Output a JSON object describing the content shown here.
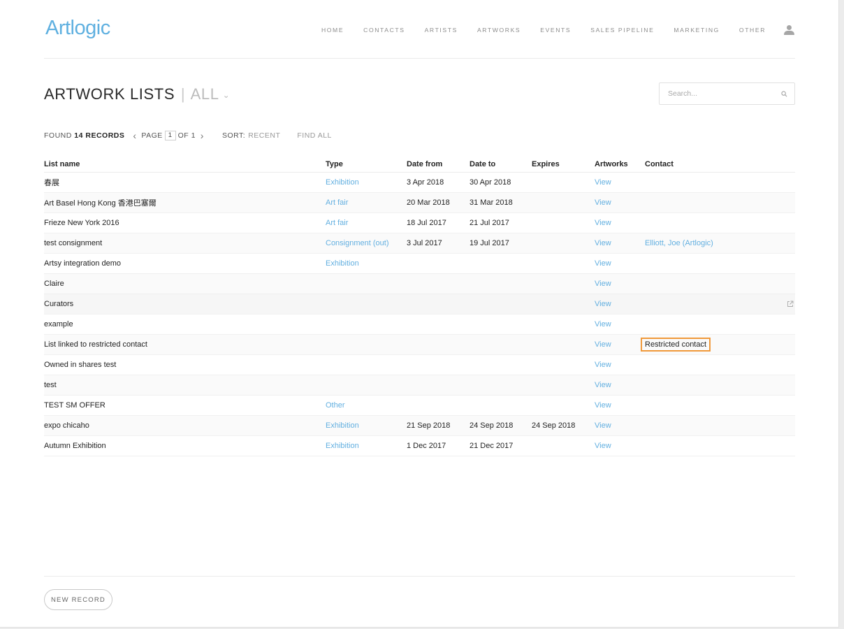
{
  "header": {
    "logo": "Artlogic",
    "nav": [
      "HOME",
      "CONTACTS",
      "ARTISTS",
      "ARTWORKS",
      "EVENTS",
      "SALES PIPELINE",
      "MARKETING",
      "OTHER"
    ],
    "user_icon": "user-icon"
  },
  "page": {
    "title": "ARTWORK LISTS",
    "separator": "|",
    "scope": "ALL",
    "scope_chevron": "⌄"
  },
  "search": {
    "placeholder": "Search...",
    "icon": "search-icon"
  },
  "toolbar": {
    "found_prefix": "FOUND",
    "found_count": "14 RECORDS",
    "page_label": "PAGE",
    "page_current": "1",
    "page_of": "OF 1",
    "sort_label": "SORT:",
    "sort_value": "RECENT",
    "find_all": "FIND ALL"
  },
  "table": {
    "columns": [
      "List name",
      "Type",
      "Date from",
      "Date to",
      "Expires",
      "Artworks",
      "Contact"
    ],
    "view_label": "View",
    "rows": [
      {
        "name": "春展",
        "type": "Exhibition",
        "date_from": "3 Apr 2018",
        "date_to": "30 Apr 2018",
        "expires": "",
        "artworks": "View",
        "contact": ""
      },
      {
        "name": "Art Basel Hong Kong 香港巴塞爾",
        "type": "Art fair",
        "date_from": "20 Mar 2018",
        "date_to": "31 Mar 2018",
        "expires": "",
        "artworks": "View",
        "contact": ""
      },
      {
        "name": "Frieze New York 2016",
        "type": "Art fair",
        "date_from": "18 Jul 2017",
        "date_to": "21 Jul 2017",
        "expires": "",
        "artworks": "View",
        "contact": ""
      },
      {
        "name": "test consignment",
        "type": "Consignment (out)",
        "date_from": "3 Jul 2017",
        "date_to": "19 Jul 2017",
        "expires": "",
        "artworks": "View",
        "contact": "Elliott, Joe (Artlogic)"
      },
      {
        "name": "Artsy integration demo",
        "type": "Exhibition",
        "date_from": "",
        "date_to": "",
        "expires": "",
        "artworks": "View",
        "contact": ""
      },
      {
        "name": "Claire",
        "type": "",
        "date_from": "",
        "date_to": "",
        "expires": "",
        "artworks": "View",
        "contact": ""
      },
      {
        "name": "Curators",
        "type": "",
        "date_from": "",
        "date_to": "",
        "expires": "",
        "artworks": "View",
        "contact": ""
      },
      {
        "name": "example",
        "type": "",
        "date_from": "",
        "date_to": "",
        "expires": "",
        "artworks": "View",
        "contact": ""
      },
      {
        "name": "List linked to restricted contact",
        "type": "",
        "date_from": "",
        "date_to": "",
        "expires": "",
        "artworks": "View",
        "contact": "Restricted contact"
      },
      {
        "name": "Owned in shares test",
        "type": "",
        "date_from": "",
        "date_to": "",
        "expires": "",
        "artworks": "View",
        "contact": ""
      },
      {
        "name": "test",
        "type": "",
        "date_from": "",
        "date_to": "",
        "expires": "",
        "artworks": "View",
        "contact": ""
      },
      {
        "name": "TEST SM OFFER",
        "type": "Other",
        "date_from": "",
        "date_to": "",
        "expires": "",
        "artworks": "View",
        "contact": ""
      },
      {
        "name": "expo chicaho",
        "type": "Exhibition",
        "date_from": "21 Sep 2018",
        "date_to": "24 Sep 2018",
        "expires": "24 Sep 2018",
        "artworks": "View",
        "contact": ""
      },
      {
        "name": "Autumn Exhibition",
        "type": "Exhibition",
        "date_from": "1 Dec 2017",
        "date_to": "21 Dec 2017",
        "expires": "",
        "artworks": "View",
        "contact": ""
      }
    ],
    "hover_row_icon": "external-link-icon"
  },
  "footer": {
    "new_record": "NEW RECORD"
  },
  "colors": {
    "accent": "#62afe0",
    "highlight_border": "#f0993a"
  }
}
